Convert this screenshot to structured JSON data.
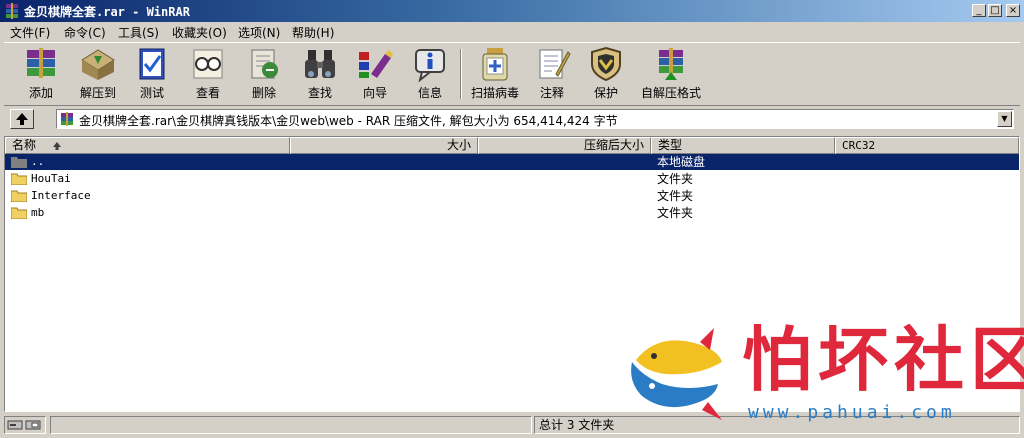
{
  "window": {
    "title": "金贝棋牌全套.rar - WinRAR",
    "buttons": {
      "minimize": "_",
      "maximize": "□",
      "close": "×"
    }
  },
  "menu": [
    {
      "label": "文件(F)"
    },
    {
      "label": "命令(C)"
    },
    {
      "label": "工具(S)"
    },
    {
      "label": "收藏夹(O)"
    },
    {
      "label": "选项(N)"
    },
    {
      "label": "帮助(H)"
    }
  ],
  "toolbar": [
    {
      "label": "添加",
      "icon": "add-archive-icon"
    },
    {
      "label": "解压到",
      "icon": "extract-to-icon"
    },
    {
      "label": "测试",
      "icon": "test-icon"
    },
    {
      "label": "查看",
      "icon": "view-icon"
    },
    {
      "label": "删除",
      "icon": "delete-icon"
    },
    {
      "label": "查找",
      "icon": "find-binoculars-icon"
    },
    {
      "label": "向导",
      "icon": "wizard-icon"
    },
    {
      "label": "信息",
      "icon": "info-icon"
    },
    {
      "label": "扫描病毒",
      "icon": "virus-scan-icon"
    },
    {
      "label": "注释",
      "icon": "comment-icon"
    },
    {
      "label": "保护",
      "icon": "protect-shield-icon"
    },
    {
      "label": "自解压格式",
      "icon": "sfx-icon"
    }
  ],
  "address": {
    "path": "金贝棋牌全套.rar\\金贝棋牌真钱版本\\金贝web\\web - RAR 压缩文件, 解包大小为 654,414,424 字节",
    "dropdown": "▼"
  },
  "columns": {
    "name": "名称",
    "size": "大小",
    "packed": "压缩后大小",
    "type": "类型",
    "crc": "CRC32"
  },
  "rows": [
    {
      "name": "..",
      "size": "",
      "packed": "",
      "type": "本地磁盘",
      "crc": "",
      "selected": true
    },
    {
      "name": "HouTai",
      "size": "",
      "packed": "",
      "type": "文件夹",
      "crc": "",
      "selected": false
    },
    {
      "name": "Interface",
      "size": "",
      "packed": "",
      "type": "文件夹",
      "crc": "",
      "selected": false
    },
    {
      "name": "mb",
      "size": "",
      "packed": "",
      "type": "文件夹",
      "crc": "",
      "selected": false
    }
  ],
  "status": {
    "summary": "总计 3 文件夹"
  },
  "watermark": {
    "text": "怕坏社区",
    "url": "www.pahuai.com"
  },
  "colors": {
    "selection": "#0a246a",
    "title_gradient_start": "#0a246a",
    "title_gradient_end": "#a6caf0",
    "watermark_red": "#e0283c",
    "watermark_blue": "#2a7cc4"
  }
}
